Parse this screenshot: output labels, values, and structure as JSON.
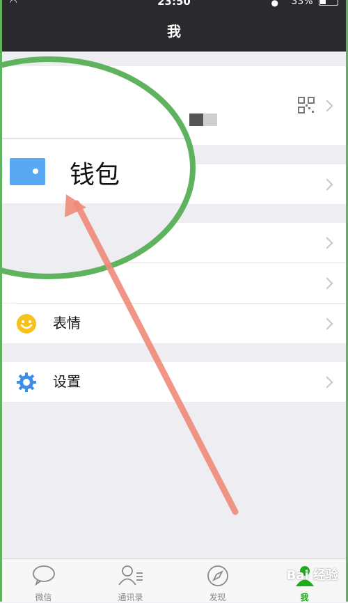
{
  "status_bar": {
    "time": "23:50",
    "battery": "33%"
  },
  "nav": {
    "title": "我"
  },
  "wallet": {
    "label": "钱包"
  },
  "menu": [
    {
      "label": "表情",
      "icon": "emoji-icon"
    },
    {
      "label": "设置",
      "icon": "gear-icon"
    }
  ],
  "tabs": [
    {
      "label": "微信",
      "icon": "chat-bubble-icon"
    },
    {
      "label": "通讯录",
      "icon": "contacts-icon"
    },
    {
      "label": "发现",
      "icon": "compass-icon"
    },
    {
      "label": "我",
      "icon": "person-icon",
      "active": true
    }
  ],
  "watermark": "Bai 经验",
  "colors": {
    "accent": "#1aad19",
    "circle": "#5fb35f",
    "arrow": "#f08a7a",
    "wallet_icon": "#58a8f2"
  }
}
